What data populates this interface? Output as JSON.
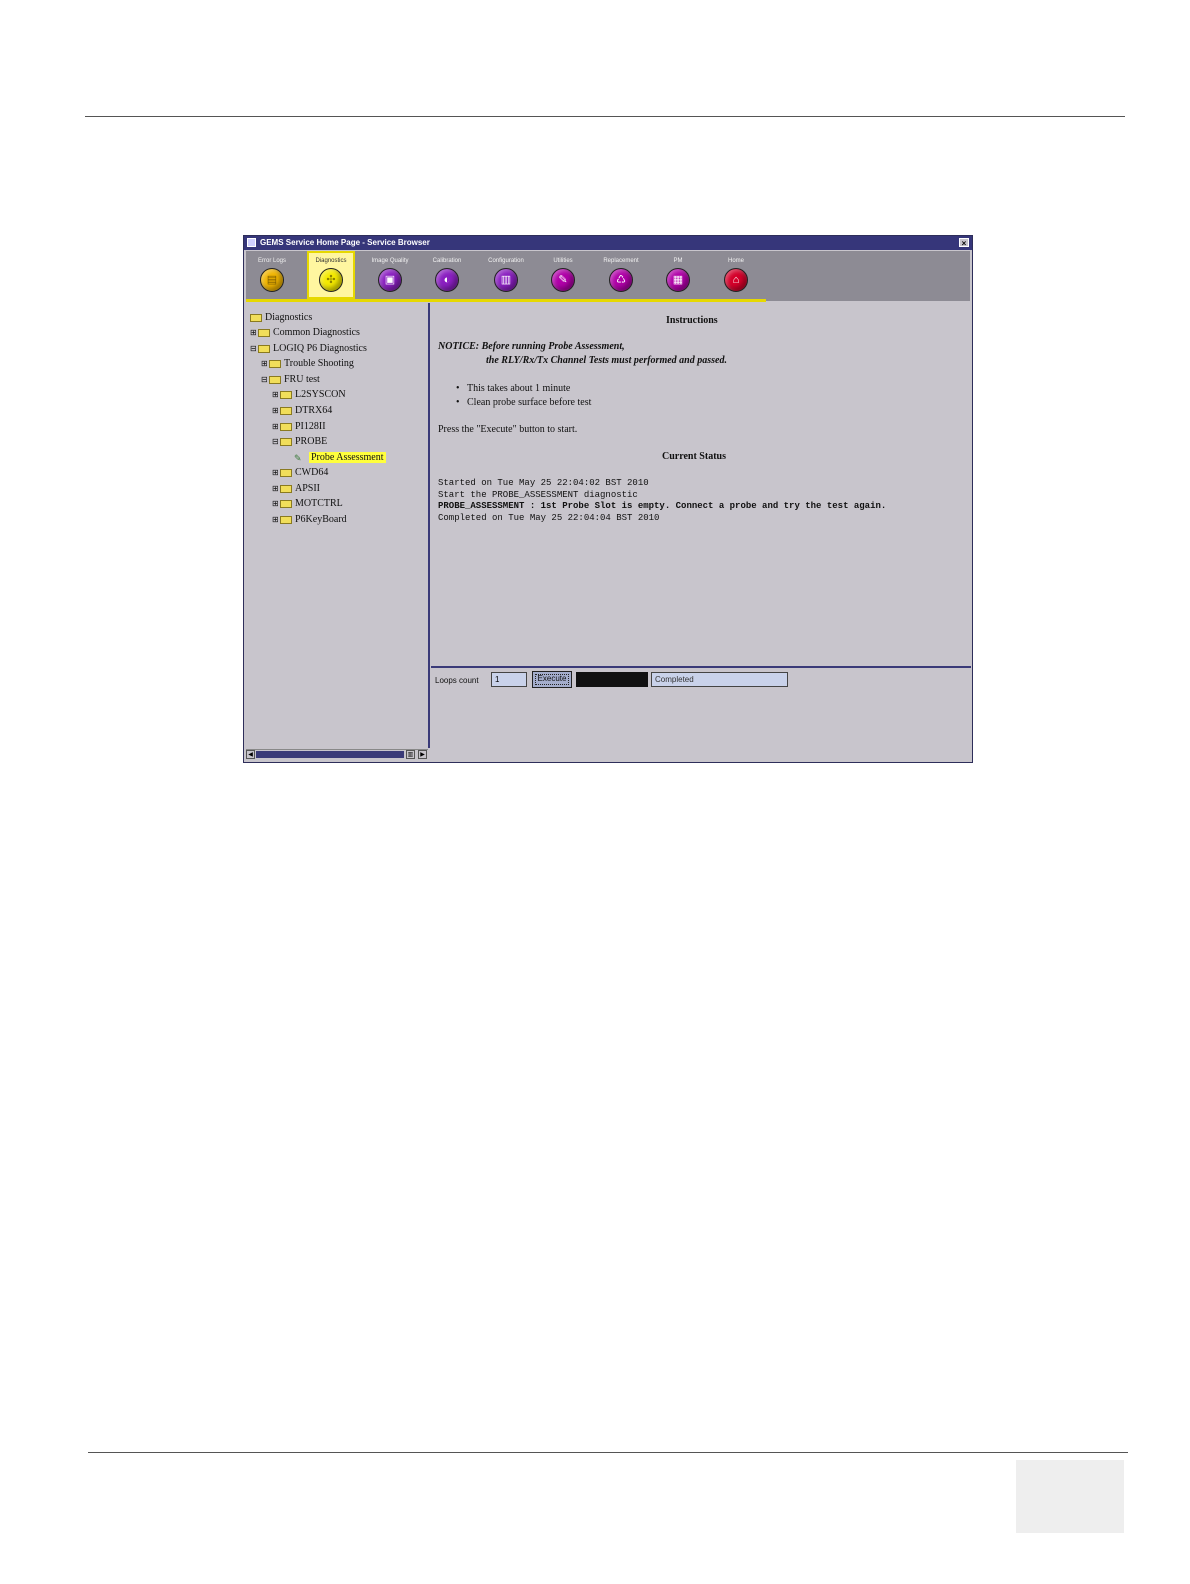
{
  "window": {
    "title": "GEMS Service Home Page - Service Browser",
    "close_glyph": "×"
  },
  "tabs": [
    {
      "label": "Error Logs",
      "icon": "error-logs-icon",
      "color": "#f0b400",
      "glyph": "▤"
    },
    {
      "label": "Diagnostics",
      "icon": "diagnostics-icon",
      "color": "#f4ea00",
      "glyph": "✣"
    },
    {
      "label": "Image Quality",
      "icon": "image-quality-icon",
      "color": "#8a1fc0",
      "glyph": "▣"
    },
    {
      "label": "Calibration",
      "icon": "calibration-icon",
      "color": "#8a1fc0",
      "glyph": "◐"
    },
    {
      "label": "Configuration",
      "icon": "configuration-icon",
      "color": "#8a1fc0",
      "glyph": "▥"
    },
    {
      "label": "Utilities",
      "icon": "utilities-icon",
      "color": "#b000a8",
      "glyph": "✎"
    },
    {
      "label": "Replacement",
      "icon": "replacement-icon",
      "color": "#b000a8",
      "glyph": "♺"
    },
    {
      "label": "PM",
      "icon": "pm-icon",
      "color": "#b000a8",
      "glyph": "▦"
    },
    {
      "label": "Home",
      "icon": "home-icon",
      "color": "#d4002a",
      "glyph": "⌂"
    }
  ],
  "active_tab": "Diagnostics",
  "tree": {
    "root": "Diagnostics",
    "common": "Common Diagnostics",
    "logiq": "LOGIQ P6 Diagnostics",
    "trouble": "Trouble Shooting",
    "fru": "FRU test",
    "l2syscon": "L2SYSCON",
    "dtrx64": "DTRX64",
    "pi128ii": "PI128II",
    "probe": "PROBE",
    "probe_assessment": "Probe Assessment",
    "cwd64": "CWD64",
    "apsii": "APSII",
    "motctrl": "MOTCTRL",
    "p6keyboard": "P6KeyBoard",
    "expand_plus": "⊞",
    "expand_minus": "⊟"
  },
  "instructions": {
    "heading": "Instructions",
    "notice_line1": "NOTICE: Before running Probe Assessment,",
    "notice_line2": "the RLY/Rx/Tx Channel Tests must performed and passed.",
    "bullet1": "This takes about 1 minute",
    "bullet2": "Clean probe surface before test",
    "press": "Press the \"Execute\" button to start.",
    "status_heading": "Current Status"
  },
  "log": [
    "Started on Tue May 25 22:04:02 BST 2010",
    "Start the PROBE_ASSESSMENT diagnostic",
    "PROBE_ASSESSMENT : 1st Probe Slot is empty. Connect a probe and try the test again.",
    "Completed on Tue May 25 22:04:04 BST 2010"
  ],
  "controls": {
    "loops_label": "Loops count",
    "loops_value": "1",
    "execute_label": "Execute",
    "status_value": "Completed"
  }
}
